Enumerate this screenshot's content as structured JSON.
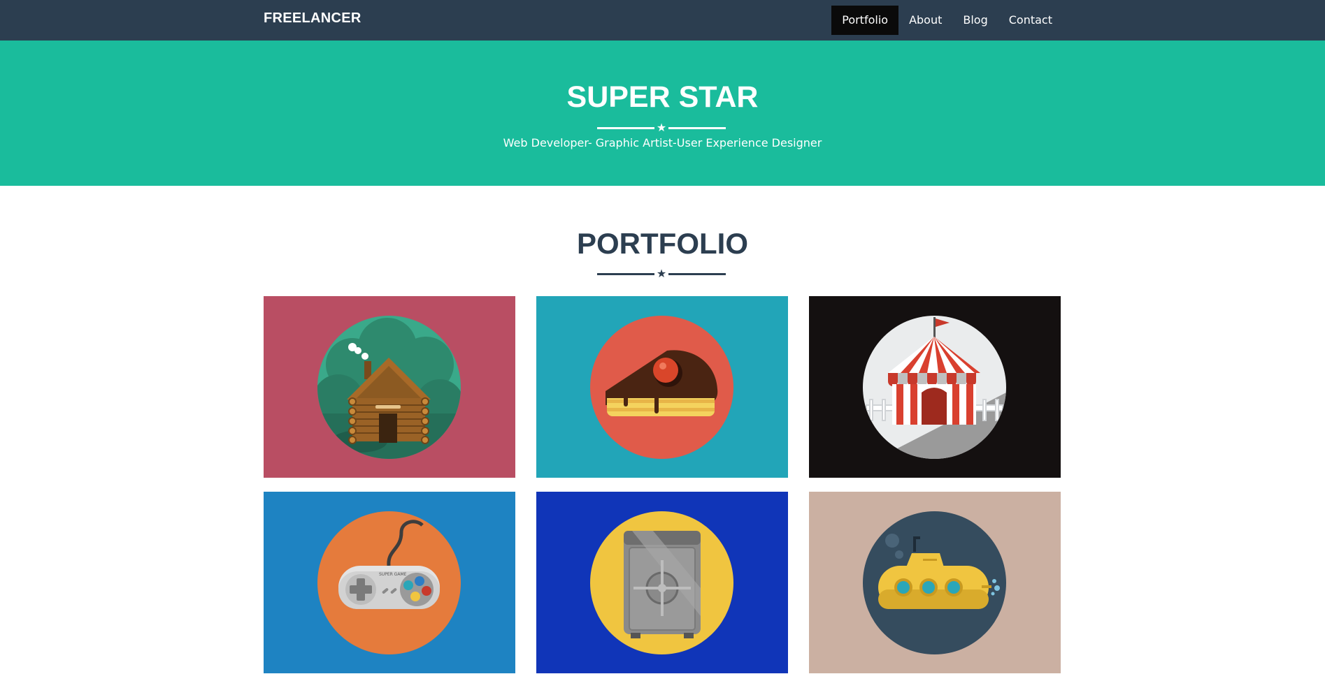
{
  "navbar": {
    "brand": "FREELANCER",
    "items": [
      {
        "label": "Portfolio",
        "active": true
      },
      {
        "label": "About"
      },
      {
        "label": "Blog"
      },
      {
        "label": "Contact"
      }
    ]
  },
  "hero": {
    "title": "SUPER STAR",
    "subtitle": "Web Developer- Graphic Artist-User Experience Designer",
    "divider_icon": "star-icon"
  },
  "portfolio": {
    "title": "PORTFOLIO",
    "divider_icon": "star-icon",
    "items": [
      {
        "icon": "cabin-icon",
        "tile_color": "#b94e63",
        "circle_color": "#3aa98a"
      },
      {
        "icon": "cake-icon",
        "tile_color": "#22a5b8",
        "circle_color": "#e05b4a"
      },
      {
        "icon": "circus-tent-icon",
        "tile_color": "#141010",
        "circle_color": "#eaeced"
      },
      {
        "icon": "game-controller-icon",
        "tile_color": "#1e83c2",
        "circle_color": "#e57b3c"
      },
      {
        "icon": "safe-icon",
        "tile_color": "#1035b8",
        "circle_color": "#f0c540"
      },
      {
        "icon": "submarine-icon",
        "tile_color": "#cbb0a2",
        "circle_color": "#354c5e"
      }
    ],
    "controller_text": "SUPER GAME"
  },
  "colors": {
    "navbar": "#2c3e50",
    "hero": "#1abc9c",
    "active_nav": "#0a0a0a",
    "heading": "#2c3e50"
  }
}
